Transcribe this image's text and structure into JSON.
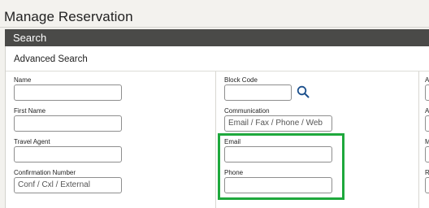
{
  "page": {
    "title": "Manage Reservation"
  },
  "search_bar": {
    "label": "Search"
  },
  "panel": {
    "subtitle": "Advanced Search"
  },
  "col1": {
    "name_label": "Name",
    "first_name_label": "First Name",
    "travel_agent_label": "Travel Agent",
    "confirmation_label": "Confirmation Number",
    "confirmation_placeholder": "Conf / Cxl / External"
  },
  "col2": {
    "block_code_label": "Block Code",
    "communication_label": "Communication",
    "communication_placeholder": "Email / Fax / Phone / Web",
    "email_label": "Email",
    "phone_label": "Phone"
  },
  "col3": {
    "labels": [
      "A",
      "A",
      "M",
      "R"
    ]
  },
  "colors": {
    "highlight": "#1ea83c",
    "header_bar": "#4a4a48"
  },
  "icons": {
    "search": "search-icon"
  }
}
